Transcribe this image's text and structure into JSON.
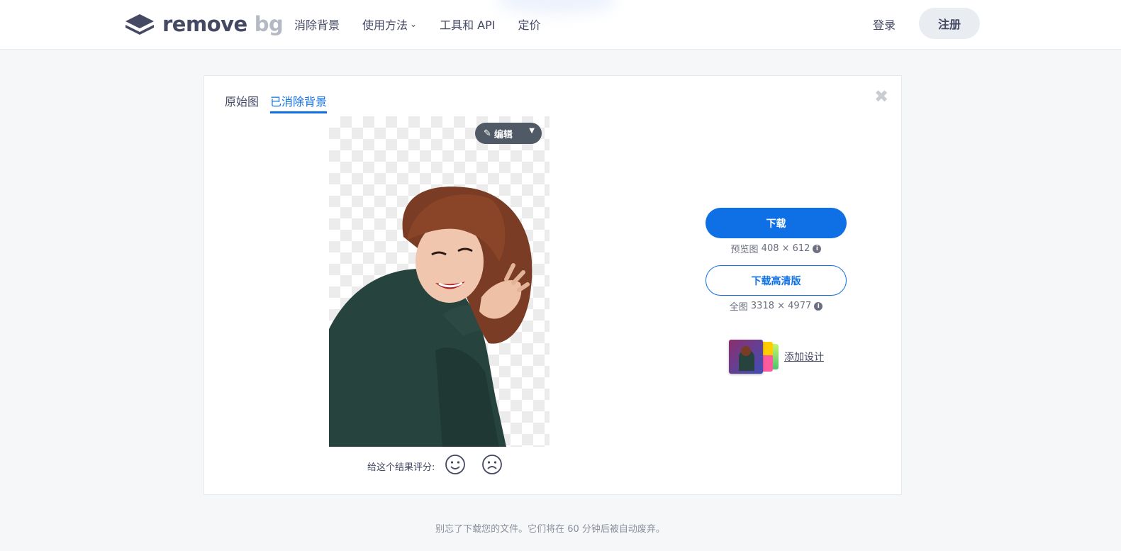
{
  "header": {
    "logo_remove": "remove",
    "logo_bg": "bg",
    "nav": [
      {
        "label": "消除背景"
      },
      {
        "label": "使用方法",
        "dropdown": true
      },
      {
        "label": "工具和 API"
      },
      {
        "label": "定价"
      }
    ],
    "login": "登录",
    "signup": "注册"
  },
  "result": {
    "tabs": [
      {
        "label": "原始图",
        "active": false
      },
      {
        "label": "已消除背景",
        "active": true
      }
    ],
    "edit_label": "编辑",
    "rating_label": "给这个结果评分:"
  },
  "actions": {
    "download_label": "下载",
    "preview_prefix": "预览图",
    "preview_size": "408 × 612",
    "download_hd_label": "下载高清版",
    "full_prefix": "全图",
    "full_size": "3318 × 4977",
    "add_design_label": "添加设计"
  },
  "footer": {
    "note": "别忘了下载您的文件。它们将在 60 分钟后被自动废弃。"
  },
  "colors": {
    "accent": "#0f70e6",
    "text": "#454964",
    "edit_button": "#4f5a66"
  }
}
